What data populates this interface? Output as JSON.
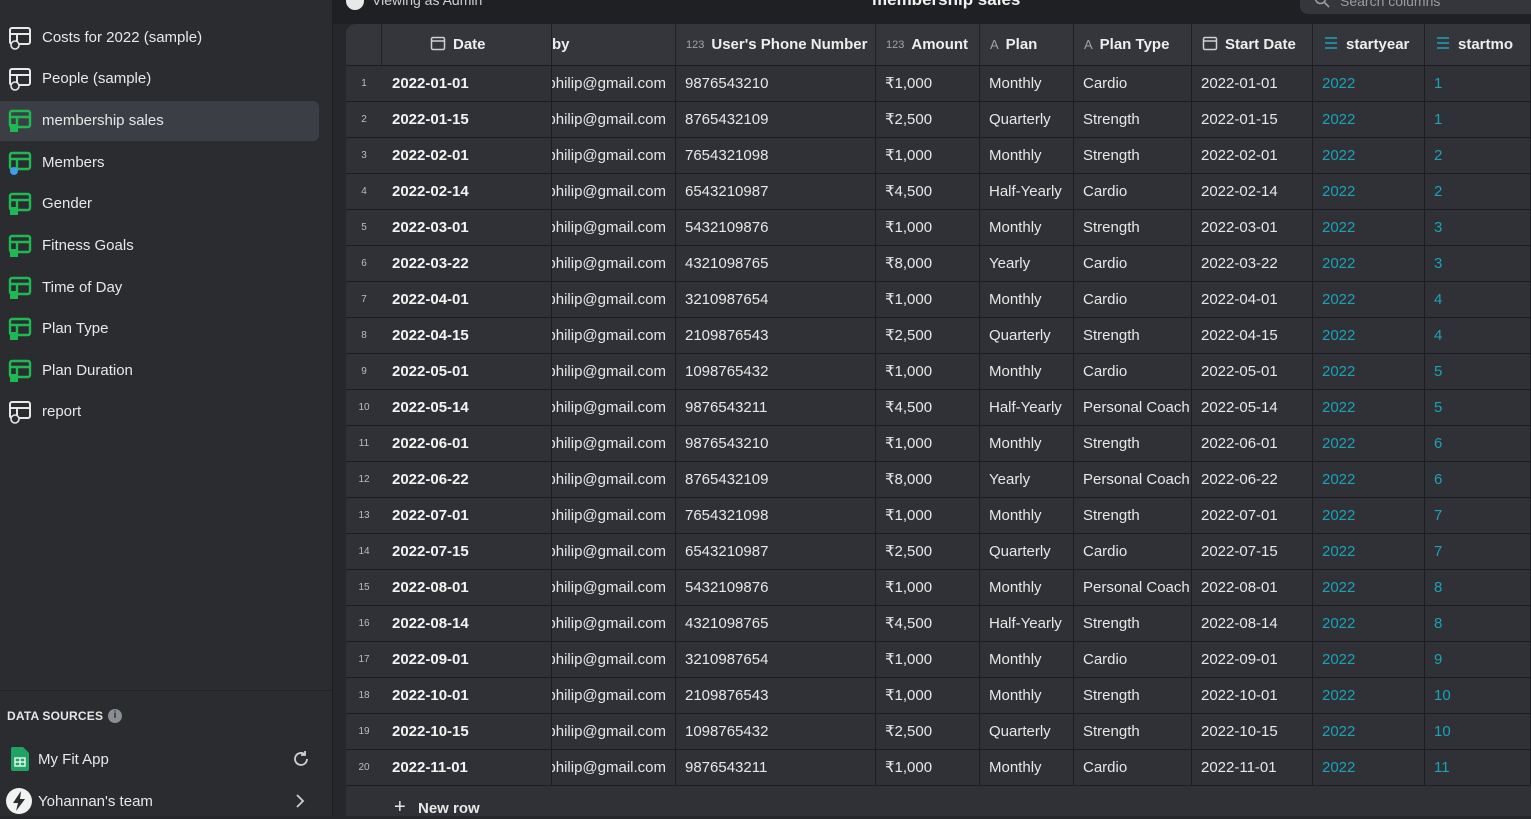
{
  "sidebar": {
    "items": [
      {
        "label": "Costs for 2022 (sample)",
        "icon": "table-icon",
        "active": false
      },
      {
        "label": "People (sample)",
        "icon": "table-icon",
        "active": false
      },
      {
        "label": "membership sales",
        "icon": "sheet-table-icon",
        "active": true
      },
      {
        "label": "Members",
        "icon": "sheet-table-user-icon",
        "active": false
      },
      {
        "label": "Gender",
        "icon": "sheet-table-icon",
        "active": false
      },
      {
        "label": "Fitness Goals",
        "icon": "sheet-table-icon",
        "active": false
      },
      {
        "label": "Time of Day",
        "icon": "sheet-table-icon",
        "active": false
      },
      {
        "label": "Plan Type",
        "icon": "sheet-table-icon",
        "active": false
      },
      {
        "label": "Plan Duration",
        "icon": "sheet-table-icon",
        "active": false
      },
      {
        "label": "report",
        "icon": "table-icon",
        "active": false
      }
    ],
    "data_sources_title": "DATA SOURCES",
    "data_source_app": "My Fit App",
    "team": "Yohannan's team"
  },
  "topbar": {
    "viewing_as": "Viewing as Admin",
    "page_title": "membership sales",
    "search_placeholder": "Search columns"
  },
  "colors": {
    "accent_green": "#1fb954",
    "teal": "#1aa3b8"
  },
  "table": {
    "columns": [
      {
        "label": "Date",
        "icon": "calendar-icon"
      },
      {
        "label": "by",
        "icon": ""
      },
      {
        "label": "User's Phone Number",
        "icon": "123"
      },
      {
        "label": "Amount",
        "icon": "123"
      },
      {
        "label": "Plan",
        "icon": "A"
      },
      {
        "label": "Plan Type",
        "icon": "A"
      },
      {
        "label": "Start Date",
        "icon": "calendar-icon"
      },
      {
        "label": "startyear",
        "icon": "formula-icon"
      },
      {
        "label": "startmo",
        "icon": "formula-icon"
      }
    ],
    "rows": [
      {
        "n": "1",
        "date": "2022-01-01",
        "email": "philip@gmail.com",
        "phone": "9876543210",
        "amount": "₹1,000",
        "plan": "Monthly",
        "type": "Cardio",
        "start": "2022-01-01",
        "year": "2022",
        "month": "1"
      },
      {
        "n": "2",
        "date": "2022-01-15",
        "email": "philip@gmail.com",
        "phone": "8765432109",
        "amount": "₹2,500",
        "plan": "Quarterly",
        "type": "Strength",
        "start": "2022-01-15",
        "year": "2022",
        "month": "1"
      },
      {
        "n": "3",
        "date": "2022-02-01",
        "email": "philip@gmail.com",
        "phone": "7654321098",
        "amount": "₹1,000",
        "plan": "Monthly",
        "type": "Strength",
        "start": "2022-02-01",
        "year": "2022",
        "month": "2"
      },
      {
        "n": "4",
        "date": "2022-02-14",
        "email": "philip@gmail.com",
        "phone": "6543210987",
        "amount": "₹4,500",
        "plan": "Half-Yearly",
        "type": "Cardio",
        "start": "2022-02-14",
        "year": "2022",
        "month": "2"
      },
      {
        "n": "5",
        "date": "2022-03-01",
        "email": "philip@gmail.com",
        "phone": "5432109876",
        "amount": "₹1,000",
        "plan": "Monthly",
        "type": "Strength",
        "start": "2022-03-01",
        "year": "2022",
        "month": "3"
      },
      {
        "n": "6",
        "date": "2022-03-22",
        "email": "philip@gmail.com",
        "phone": "4321098765",
        "amount": "₹8,000",
        "plan": "Yearly",
        "type": "Cardio",
        "start": "2022-03-22",
        "year": "2022",
        "month": "3"
      },
      {
        "n": "7",
        "date": "2022-04-01",
        "email": "philip@gmail.com",
        "phone": "3210987654",
        "amount": "₹1,000",
        "plan": "Monthly",
        "type": "Cardio",
        "start": "2022-04-01",
        "year": "2022",
        "month": "4"
      },
      {
        "n": "8",
        "date": "2022-04-15",
        "email": "philip@gmail.com",
        "phone": "2109876543",
        "amount": "₹2,500",
        "plan": "Quarterly",
        "type": "Strength",
        "start": "2022-04-15",
        "year": "2022",
        "month": "4"
      },
      {
        "n": "9",
        "date": "2022-05-01",
        "email": "philip@gmail.com",
        "phone": "1098765432",
        "amount": "₹1,000",
        "plan": "Monthly",
        "type": "Cardio",
        "start": "2022-05-01",
        "year": "2022",
        "month": "5"
      },
      {
        "n": "10",
        "date": "2022-05-14",
        "email": "philip@gmail.com",
        "phone": "9876543211",
        "amount": "₹4,500",
        "plan": "Half-Yearly",
        "type": "Personal Coach",
        "start": "2022-05-14",
        "year": "2022",
        "month": "5"
      },
      {
        "n": "11",
        "date": "2022-06-01",
        "email": "philip@gmail.com",
        "phone": "9876543210",
        "amount": "₹1,000",
        "plan": "Monthly",
        "type": "Strength",
        "start": "2022-06-01",
        "year": "2022",
        "month": "6"
      },
      {
        "n": "12",
        "date": "2022-06-22",
        "email": "philip@gmail.com",
        "phone": "8765432109",
        "amount": "₹8,000",
        "plan": "Yearly",
        "type": "Personal Coach",
        "start": "2022-06-22",
        "year": "2022",
        "month": "6"
      },
      {
        "n": "13",
        "date": "2022-07-01",
        "email": "philip@gmail.com",
        "phone": "7654321098",
        "amount": "₹1,000",
        "plan": "Monthly",
        "type": "Strength",
        "start": "2022-07-01",
        "year": "2022",
        "month": "7"
      },
      {
        "n": "14",
        "date": "2022-07-15",
        "email": "philip@gmail.com",
        "phone": "6543210987",
        "amount": "₹2,500",
        "plan": "Quarterly",
        "type": "Cardio",
        "start": "2022-07-15",
        "year": "2022",
        "month": "7"
      },
      {
        "n": "15",
        "date": "2022-08-01",
        "email": "philip@gmail.com",
        "phone": "5432109876",
        "amount": "₹1,000",
        "plan": "Monthly",
        "type": "Personal Coach",
        "start": "2022-08-01",
        "year": "2022",
        "month": "8"
      },
      {
        "n": "16",
        "date": "2022-08-14",
        "email": "philip@gmail.com",
        "phone": "4321098765",
        "amount": "₹4,500",
        "plan": "Half-Yearly",
        "type": "Strength",
        "start": "2022-08-14",
        "year": "2022",
        "month": "8"
      },
      {
        "n": "17",
        "date": "2022-09-01",
        "email": "philip@gmail.com",
        "phone": "3210987654",
        "amount": "₹1,000",
        "plan": "Monthly",
        "type": "Cardio",
        "start": "2022-09-01",
        "year": "2022",
        "month": "9"
      },
      {
        "n": "18",
        "date": "2022-10-01",
        "email": "philip@gmail.com",
        "phone": "2109876543",
        "amount": "₹1,000",
        "plan": "Monthly",
        "type": "Strength",
        "start": "2022-10-01",
        "year": "2022",
        "month": "10"
      },
      {
        "n": "19",
        "date": "2022-10-15",
        "email": "philip@gmail.com",
        "phone": "1098765432",
        "amount": "₹2,500",
        "plan": "Quarterly",
        "type": "Strength",
        "start": "2022-10-15",
        "year": "2022",
        "month": "10"
      },
      {
        "n": "20",
        "date": "2022-11-01",
        "email": "philip@gmail.com",
        "phone": "9876543211",
        "amount": "₹1,000",
        "plan": "Monthly",
        "type": "Cardio",
        "start": "2022-11-01",
        "year": "2022",
        "month": "11"
      }
    ],
    "new_row_label": "New row"
  }
}
